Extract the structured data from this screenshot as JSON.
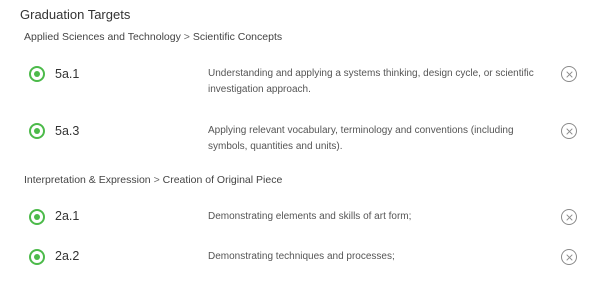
{
  "title": "Graduation Targets",
  "groups": [
    {
      "path": {
        "area": "Applied Sciences and Technology",
        "separator": ">",
        "topic": "Scientific Concepts"
      },
      "targets": [
        {
          "code": "5a.1",
          "description": "Understanding and applying a systems thinking, design cycle, or scientific investigation approach.",
          "selected": true,
          "select_icon": "radio-checked-icon",
          "remove_icon": "close-circle-icon"
        },
        {
          "code": "5a.3",
          "description": "Applying relevant vocabulary, terminology and conventions (including symbols, quantities and units).",
          "selected": true,
          "select_icon": "radio-checked-icon",
          "remove_icon": "close-circle-icon"
        }
      ]
    },
    {
      "path": {
        "area": "Interpretation & Expression",
        "separator": ">",
        "topic": "Creation of Original Piece"
      },
      "targets": [
        {
          "code": "2a.1",
          "description": "Demonstrating elements and skills of art form;",
          "selected": true,
          "select_icon": "radio-checked-icon",
          "remove_icon": "close-circle-icon"
        },
        {
          "code": "2a.2",
          "description": "Demonstrating techniques and processes;",
          "selected": true,
          "select_icon": "radio-checked-icon",
          "remove_icon": "close-circle-icon"
        }
      ]
    }
  ],
  "colors": {
    "accent_green": "#4cba4a",
    "remove_icon_gray": "#8a8a8a",
    "text_dark": "#333333",
    "text_muted": "#555555"
  }
}
